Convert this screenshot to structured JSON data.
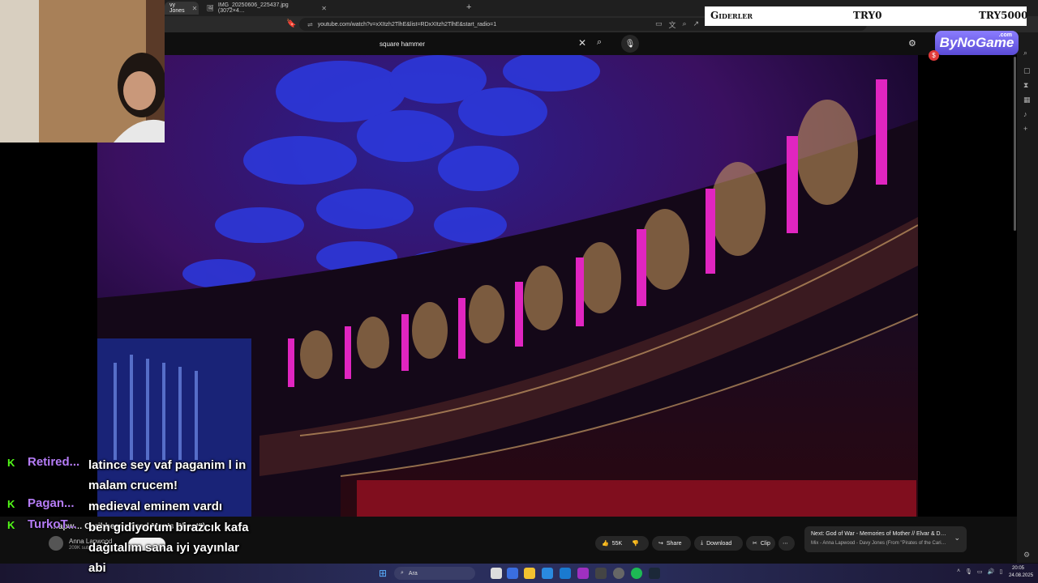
{
  "browser": {
    "tabs": [
      {
        "label": "vy Jones",
        "active": true
      },
      {
        "label": "IMG_20250606_225437.jpg (3072×4…",
        "active": false
      }
    ],
    "url": "youtube.com/watch?v=xXItzh2TlhE&list=RDxXItzh2TlhE&start_radio=1"
  },
  "youtube": {
    "search_query": "square hammer",
    "video_title": "…apw… Caribbean: Dead Man's Chest\")",
    "channel_name": "Anna Lapwood",
    "subscribers": "209K sub…",
    "likes": "55K",
    "share_label": "Share",
    "download_label": "Download",
    "clip_label": "Clip",
    "up_next": {
      "title": "Next: God of War - Memories of Mother // Elvar & D…",
      "subtitle": "Mix - Anna Lapwood - Davy Jones (From \"Pirates of the Cari…"
    }
  },
  "overlay": {
    "expense_labels": [
      "Giderler",
      "TRY0",
      "TRY5000"
    ],
    "sponsor": "ByNoGame",
    "sponsor_domain": ".com",
    "chat": [
      {
        "user": "Retired...",
        "message": "latince sey vaf paganim l in malam crucem!"
      },
      {
        "user": "Pagan...",
        "message": "medieval eminem vardı"
      },
      {
        "user": "TurkoT...",
        "message": "ben gidiyorum birazcık kafa dağıtalım sana iyi yayınlar abi"
      }
    ]
  },
  "taskbar": {
    "search_placeholder": "Ara",
    "time": "20:05",
    "date": "24.08.2025"
  },
  "colors": {
    "kick_green": "#53fc18",
    "chat_username": "#b57cf6",
    "sponsor_purple": "#6a5be0"
  }
}
